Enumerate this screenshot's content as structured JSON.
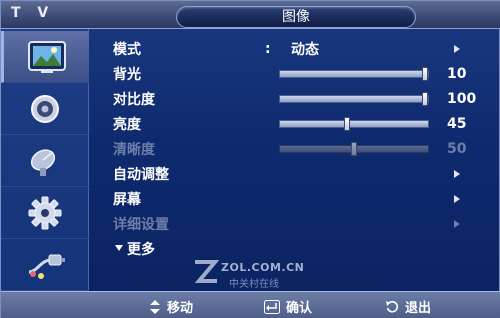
{
  "header": {
    "brand": "T V",
    "title": "图像"
  },
  "sidebar": {
    "tabs": [
      {
        "name": "picture",
        "icon": "picture-icon",
        "selected": true
      },
      {
        "name": "sound",
        "icon": "speaker-icon",
        "selected": false
      },
      {
        "name": "channel",
        "icon": "satellite-dish-icon",
        "selected": false
      },
      {
        "name": "setup",
        "icon": "gear-icon",
        "selected": false
      },
      {
        "name": "input",
        "icon": "input-cable-icon",
        "selected": false
      }
    ]
  },
  "menu": {
    "mode": {
      "label": "模式",
      "colon": ":",
      "value": "动态"
    },
    "backlight": {
      "label": "背光",
      "value": "10",
      "level": 1.0
    },
    "contrast": {
      "label": "对比度",
      "value": "100",
      "level": 1.0
    },
    "brightness": {
      "label": "亮度",
      "value": "45",
      "level": 0.45
    },
    "sharpness": {
      "label": "清晰度",
      "value": "50",
      "level": 0.5,
      "disabled": true
    },
    "auto_adjust": {
      "label": "自动调整"
    },
    "screen": {
      "label": "屏幕"
    },
    "advanced": {
      "label": "详细设置",
      "disabled": true
    },
    "more": {
      "label": "更多"
    }
  },
  "watermark": {
    "text": "ZOL.COM.CN",
    "sub": "中关村在线"
  },
  "footer": {
    "move": "移动",
    "enter": "确认",
    "exit": "退出"
  },
  "colors": {
    "background": "#0e2a6e",
    "selected_tab": "#4f62a0",
    "disabled_text": "#6d7ea8"
  }
}
